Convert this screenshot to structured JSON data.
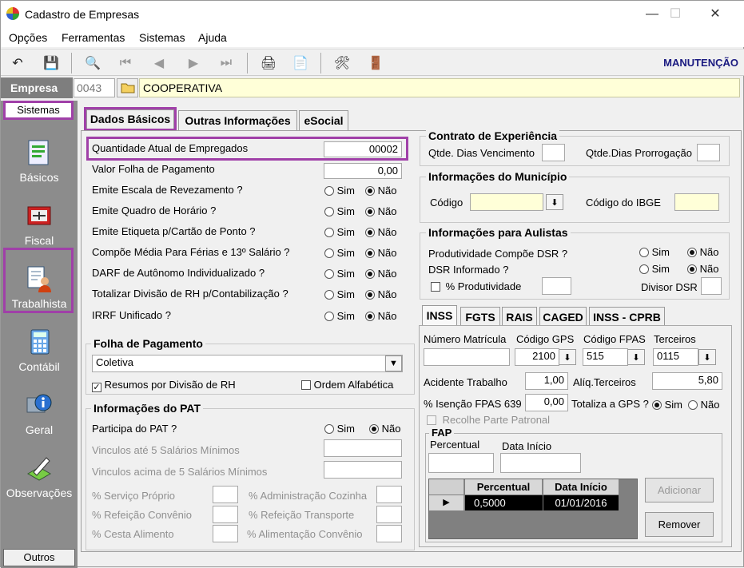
{
  "window": {
    "title": "Cadastro de Empresas"
  },
  "menu": [
    "Opções",
    "Ferramentas",
    "Sistemas",
    "Ajuda"
  ],
  "toolbar": {
    "mode": "MANUTENÇÃO"
  },
  "empresa": {
    "label": "Empresa",
    "code": "0043",
    "name": "COOPERATIVA"
  },
  "sidebar": {
    "header": "Sistemas",
    "items": [
      {
        "label": "Básicos",
        "icon": "basicos-icon"
      },
      {
        "label": "Fiscal",
        "icon": "fiscal-icon"
      },
      {
        "label": "Trabalhista",
        "icon": "trabalhista-icon"
      },
      {
        "label": "Contábil",
        "icon": "calculator-icon"
      },
      {
        "label": "Geral",
        "icon": "info-icon"
      },
      {
        "label": "Observações",
        "icon": "pen-icon"
      }
    ],
    "footer": "Outros"
  },
  "tabs": [
    "Dados Básicos",
    "Outras Informações",
    "eSocial"
  ],
  "basicos": {
    "qtd_label": "Quantidade Atual de Empregados",
    "qtd_value": "00002",
    "folha_label": "Valor Folha de Pagamento",
    "folha_value": "0,00",
    "sim": "Sim",
    "nao": "Não",
    "questions": [
      "Emite Escala de Revezamento ?",
      "Emite Quadro de Horário ?",
      "Emite Etiqueta p/Cartão de Ponto ?",
      "Compõe Média Para Férias e 13º Salário ?",
      "DARF de Autônomo Individualizado ?",
      "Totalizar Divisão de RH p/Contabilização ?",
      "IRRF Unificado ?"
    ]
  },
  "folha": {
    "title": "Folha de Pagamento",
    "tipo": "Coletiva",
    "resumos": "Resumos por Divisão de RH",
    "ordem": "Ordem Alfabética"
  },
  "pat": {
    "title": "Informações do PAT",
    "participa": "Participa do PAT ?",
    "vinc_ate": "Vinculos até 5 Salários Mínimos",
    "vinc_acima": "Vinculos acima de 5 Salários Mínimos",
    "servico": "% Serviço Próprio",
    "admin": "% Administração Cozinha",
    "refeicao_conv": "% Refeição Convênio",
    "refeicao_transp": "% Refeição Transporte",
    "cesta": "% Cesta Alimento",
    "alimentacao": "% Alimentação Convênio"
  },
  "contrato": {
    "title": "Contrato de Experiência",
    "dias_venc": "Qtde. Dias Vencimento",
    "dias_prorr": "Qtde.Dias Prorrogação"
  },
  "municipio": {
    "title": "Informações do Município",
    "codigo": "Código",
    "ibge": "Código do IBGE"
  },
  "aulistas": {
    "title": "Informações para Aulistas",
    "produtividade": "Produtividade Compõe DSR ?",
    "dsr": "DSR Informado ?",
    "perc_prod": "% Produtividade",
    "divisor": "Divisor DSR"
  },
  "subtabs": [
    "INSS",
    "FGTS",
    "RAIS",
    "CAGED",
    "INSS - CPRB"
  ],
  "inss": {
    "matricula": "Número Matrícula",
    "gps": "Código GPS",
    "gps_value": "2100",
    "fpas": "Código FPAS",
    "fpas_value": "515",
    "terceiros": "Terceiros",
    "terceiros_value": "0115",
    "acidente": "Acidente Trabalho",
    "acidente_value": "1,00",
    "aliq": "Alíq.Terceiros",
    "aliq_value": "5,80",
    "isencao": "% Isenção FPAS 639",
    "isencao_value": "0,00",
    "totaliza": "Totaliza a GPS ?",
    "recolhe": "Recolhe Parte Patronal"
  },
  "fap": {
    "title": "FAP",
    "percentual": "Percentual",
    "data_inicio": "Data Início",
    "grid_headers": [
      "Percentual",
      "Data Início"
    ],
    "rows": [
      {
        "percentual": "0,5000",
        "data": "01/01/2016"
      }
    ],
    "add": "Adicionar",
    "remove": "Remover"
  }
}
